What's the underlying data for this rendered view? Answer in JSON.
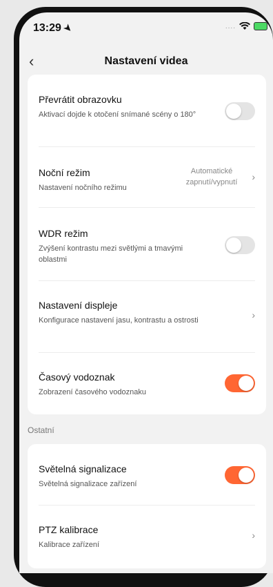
{
  "status_bar": {
    "time": "13:29",
    "dots": "....",
    "battery_color": "#4cd964"
  },
  "nav": {
    "title": "Nastavení videa",
    "back_icon": "chevron-left-icon"
  },
  "accent_color": "#ff6633",
  "settings": [
    {
      "title": "Převrátit obrazovku",
      "subtitle": "Aktivací dojde k otočení snímané scény o 180°",
      "control": "toggle",
      "on": false
    },
    {
      "title": "Noční režim",
      "subtitle": "Nastavení nočního režimu",
      "control": "value",
      "value": "Automatické zapnutí/vypnutí"
    },
    {
      "title": "WDR režim",
      "subtitle": "Zvýšení kontrastu mezi světlými a tmavými oblastmi",
      "control": "toggle",
      "on": false
    },
    {
      "title": "Nastavení displeje",
      "subtitle": "Konfigurace nastavení jasu, kontrastu a ostrosti",
      "control": "chevron"
    },
    {
      "title": "Časový vodoznak",
      "subtitle": "Zobrazení časového vodoznaku",
      "control": "toggle",
      "on": true
    }
  ],
  "other_section": {
    "label": "Ostatní",
    "items": [
      {
        "title": "Světelná signalizace",
        "subtitle": "Světelná signalizace zařízení",
        "control": "toggle",
        "on": true
      },
      {
        "title": "PTZ kalibrace",
        "subtitle": "Kalibrace zařízení",
        "control": "chevron"
      }
    ]
  }
}
